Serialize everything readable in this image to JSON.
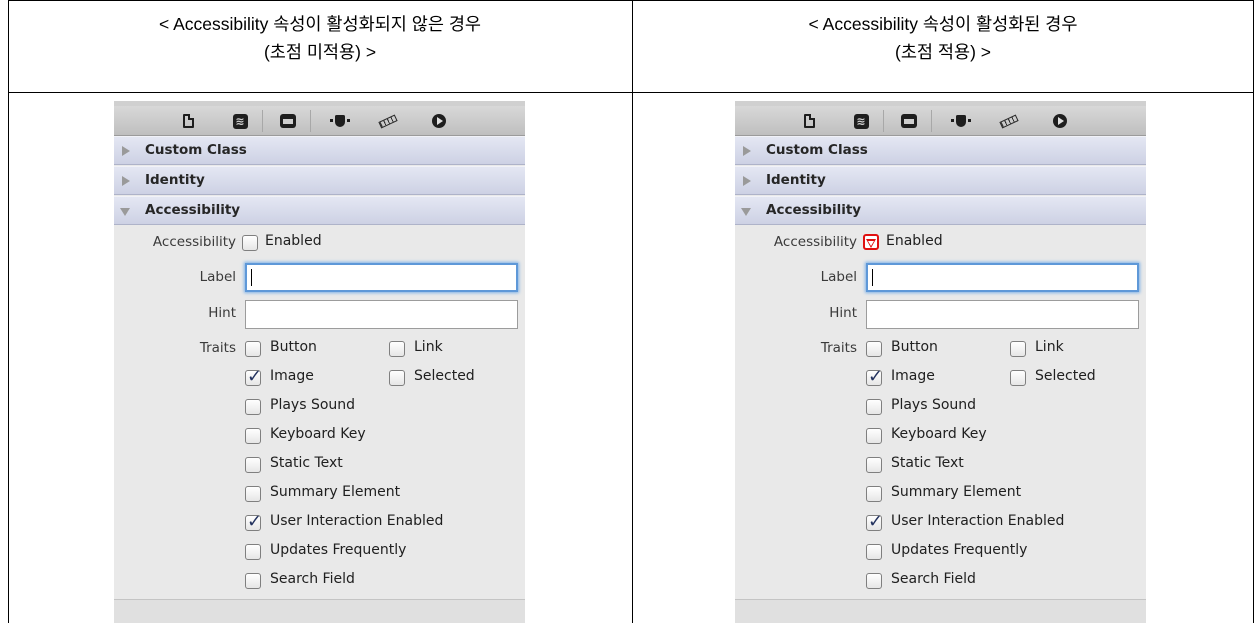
{
  "headers": {
    "left": [
      "< Accessibility 속성이 활성화되지 않은 경우",
      "(초점 미적용) >"
    ],
    "right": [
      "< Accessibility 속성이 활성화된 경우",
      "(초점 적용) >"
    ]
  },
  "toolbar_icons": [
    "file-inspector-icon",
    "identity-inspector-icon",
    "attributes-inspector-icon",
    "size-inspector-icon",
    "ruler-icon",
    "connections-inspector-icon"
  ],
  "sections": [
    "Custom Class",
    "Identity",
    "Accessibility"
  ],
  "labels": {
    "accessibility": "Accessibility",
    "enabled": "Enabled",
    "label": "Label",
    "hint": "Hint",
    "traits": "Traits"
  },
  "traits": {
    "button": "Button",
    "link": "Link",
    "image": "Image",
    "selected": "Selected",
    "plays_sound": "Plays Sound",
    "keyboard_key": "Keyboard Key",
    "static_text": "Static Text",
    "summary_element": "Summary Element",
    "user_interaction_enabled": "User Interaction Enabled",
    "updates_frequently": "Updates Frequently",
    "search_field": "Search Field"
  },
  "states": {
    "left": {
      "accessibility_enabled": false,
      "image": true,
      "user_interaction_enabled": true,
      "label_value": "",
      "hint_value": ""
    },
    "right": {
      "accessibility_enabled": true,
      "image": true,
      "user_interaction_enabled": true,
      "label_value": "",
      "hint_value": ""
    }
  },
  "colors": {
    "section_bg": "#cdd1e4",
    "focus_ring": "#5e98d8",
    "highlight_red": "#e01010",
    "check": "#24335f"
  }
}
